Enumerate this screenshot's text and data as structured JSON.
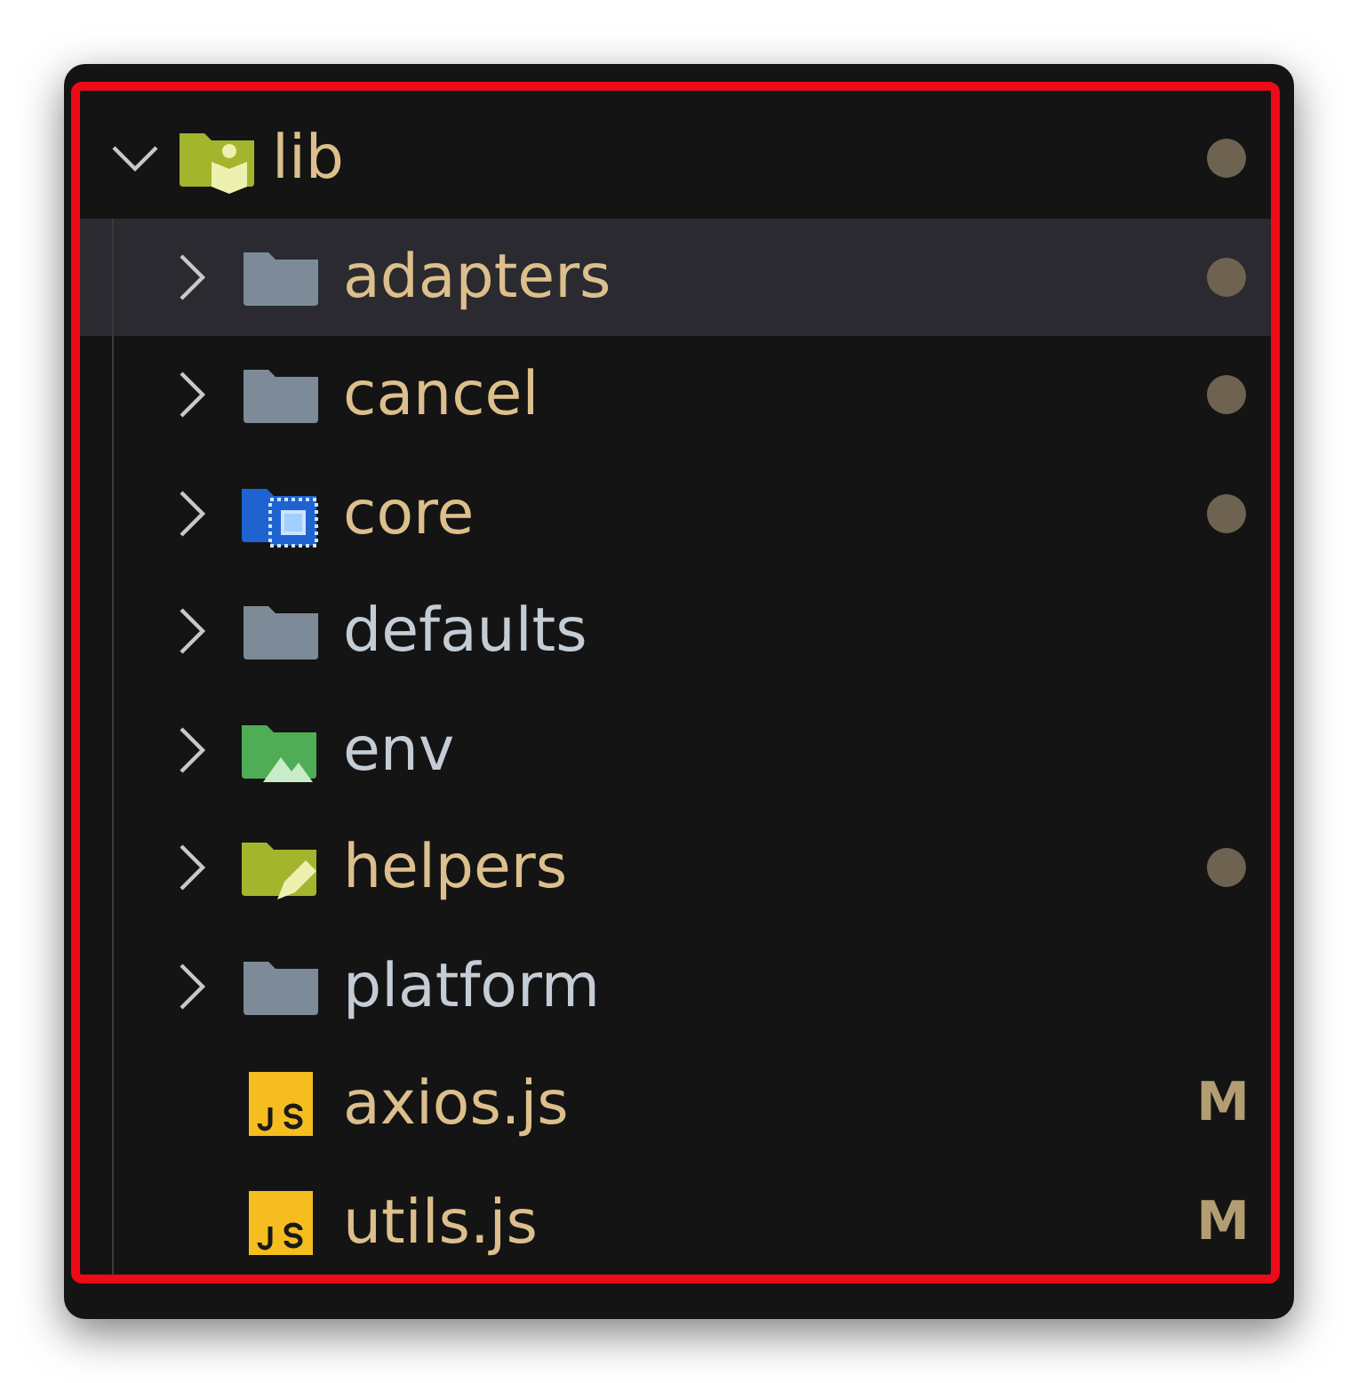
{
  "explorer": {
    "root": {
      "name": "lib",
      "kind": "library",
      "expanded": true,
      "modified": true,
      "selected": false,
      "children": [
        {
          "name": "adapters",
          "kind": "folder",
          "expanded": false,
          "modified": true,
          "selected": true
        },
        {
          "name": "cancel",
          "kind": "folder",
          "expanded": false,
          "modified": true,
          "selected": false
        },
        {
          "name": "core",
          "kind": "core",
          "expanded": false,
          "modified": true,
          "selected": false
        },
        {
          "name": "defaults",
          "kind": "folder",
          "expanded": false,
          "modified": false,
          "selected": false
        },
        {
          "name": "env",
          "kind": "env",
          "expanded": false,
          "modified": false,
          "selected": false
        },
        {
          "name": "helpers",
          "kind": "helpers",
          "expanded": false,
          "modified": true,
          "selected": false
        },
        {
          "name": "platform",
          "kind": "folder",
          "expanded": false,
          "modified": false,
          "selected": false
        },
        {
          "name": "axios.js",
          "kind": "javascript",
          "modified": true,
          "selected": false,
          "badge": "M"
        },
        {
          "name": "utils.js",
          "kind": "javascript",
          "modified": true,
          "selected": false,
          "badge": "M"
        }
      ]
    }
  }
}
